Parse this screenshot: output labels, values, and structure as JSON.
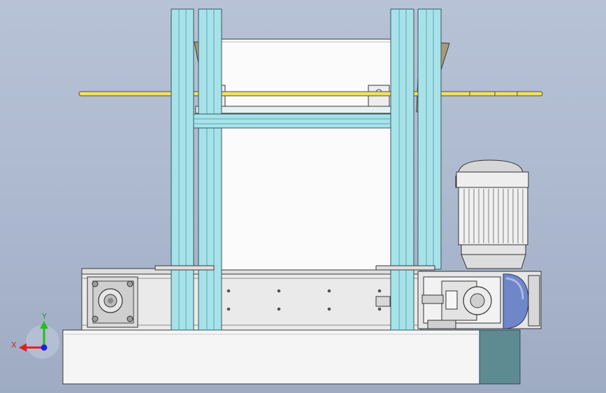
{
  "viewport": {
    "background_top": "#b7c2d6",
    "background_bottom": "#9eabc3"
  },
  "triad": {
    "x_label": "X",
    "y_label": "Y",
    "x_color": "#e02020",
    "y_color": "#20c020",
    "origin_color": "#2020e0"
  },
  "colors": {
    "frame_profile": "#a8e2e8",
    "frame_profile_dark": "#4fa9b8",
    "hopper": "#a79a7a",
    "shaft": "#f0e06a",
    "base": "#f4f4f4",
    "base_side": "#5e8a92",
    "motor_body": "#f0f0f0",
    "motor_fins": "#dadada",
    "gearbox_cap": "#6f86c8"
  },
  "components": [
    "frame",
    "hopper",
    "drive-shaft",
    "conveyor-housing",
    "bearing-housing",
    "gear-motor",
    "base-plate"
  ]
}
